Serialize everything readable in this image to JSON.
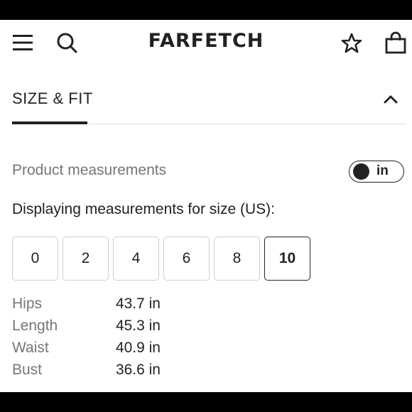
{
  "header": {
    "logo": "FARFETCH",
    "icons": {
      "menu": "hamburger-menu-icon",
      "search": "search-icon",
      "wishlist": "star-icon",
      "bag": "shopping-bag-icon"
    }
  },
  "section": {
    "title": "SIZE & FIT",
    "toggle_icon": "chevron-up-icon"
  },
  "measurements": {
    "label": "Product measurements",
    "unit_toggle": {
      "value": "in",
      "state": "on"
    },
    "size_heading": "Displaying measurements for size (US):",
    "sizes": [
      "0",
      "2",
      "4",
      "6",
      "8",
      "10"
    ],
    "selected_size": "10",
    "rows": [
      {
        "name": "Hips",
        "value": "43.7 in"
      },
      {
        "name": "Length",
        "value": "45.3 in"
      },
      {
        "name": "Waist",
        "value": "40.9 in"
      },
      {
        "name": "Bust",
        "value": "36.6 in"
      }
    ]
  },
  "colors": {
    "text": "#222222",
    "muted": "#767676",
    "border": "#cfcfcf"
  }
}
